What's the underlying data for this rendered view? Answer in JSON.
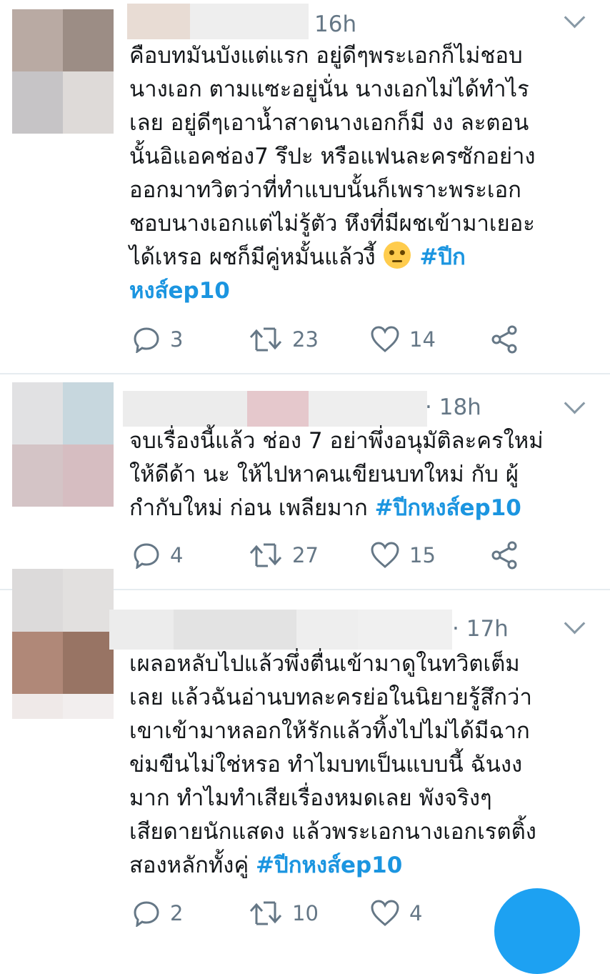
{
  "tweets": [
    {
      "time": "16h",
      "text_before": "คือบทมันบังแต่แรก อยู่ดีๆพระเอกก็ไม่ชอบ\nนางเอก ตามแซะอยู่นั่น นางเอกไม่ได้ทำไร\nเลย อยู่ดีๆเอาน้ำสาดนางเอกก็มี งง ละตอน\nนั้นอิแอคช่อง7 รึปะ หรือแฟนละครซักอย่าง\nออกมาทวิตว่าที่ทำแบบนั้นก็เพราะพระเอก\nชอบนางเอกแต่ไม่รู้ตัว หึงที่มีผชเข้ามาเยอะ\nได้เหรอ ผชก็มีคู่หมั้นแล้วงี้ ",
      "emoji": "face-with-rolling-eyes",
      "hashtag": "#ปีก\nหงส์ep10",
      "replies": "3",
      "retweets": "23",
      "likes": "14"
    },
    {
      "time": "18h",
      "text_before": "จบเรื่องนี้แล้ว ช่อง 7 อย่าพึ่งอนุมัติละครใหม่\nให้ดีด้า นะ ให้ไปหาคนเขียนบทใหม่ กับ ผู้\nกำกับใหม่ ก่อน เพลียมาก ",
      "hashtag": "#ปีกหงส์ep10",
      "replies": "4",
      "retweets": "27",
      "likes": "15"
    },
    {
      "time": "17h",
      "text_before": "เผลอหลับไปแล้วพึ่งตื่นเข้ามาดูในทวิตเต็ม\nเลย แล้วฉันอ่านบทละครย่อในนิยายรู้สึกว่า\nเขาเข้ามาหลอกให้รักแล้วทิ้งไปไม่ได้มีฉาก\nข่มขืนไม่ใช่หรอ ทำไมบทเป็นแบบนี้ ฉันงง\nมาก ทำไมทำเสียเรื่องหมดเลย พังจริงๆ\nเสียดายนักแสดง แล้วพระเอกนางเอกเรตติ้ง\nสองหลักทั้งคู่ ",
      "hashtag": "#ปีกหงส์ep10",
      "replies": "2",
      "retweets": "10",
      "likes": "4"
    }
  ],
  "colors": {
    "link": "#1b95e0",
    "muted": "#657786",
    "fab": "#1da1f2"
  }
}
